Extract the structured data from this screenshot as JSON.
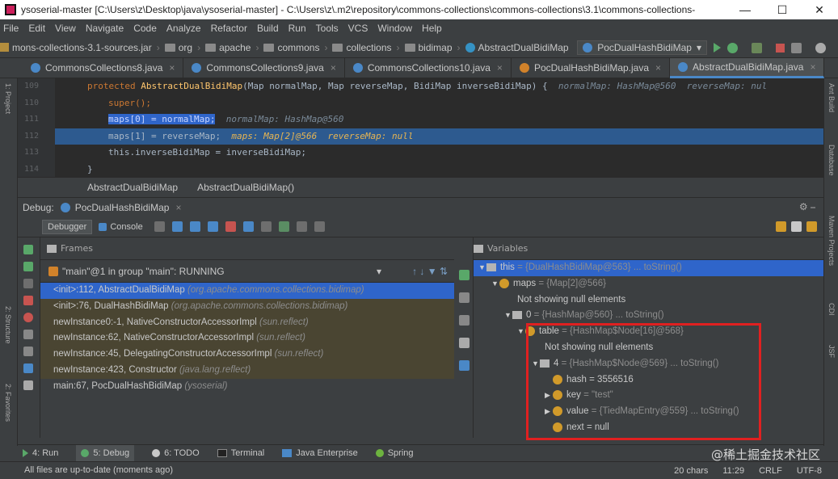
{
  "window": {
    "title": "ysoserial-master [C:\\Users\\z\\Desktop\\java\\ysoserial-master] - C:\\Users\\z\\.m2\\repository\\commons-collections\\commons-collections\\3.1\\commons-collections-",
    "controls": [
      "—",
      "☐",
      "✕"
    ]
  },
  "menu": [
    "File",
    "Edit",
    "View",
    "Navigate",
    "Code",
    "Analyze",
    "Refactor",
    "Build",
    "Run",
    "Tools",
    "VCS",
    "Window",
    "Help"
  ],
  "nav": {
    "crumbs": [
      "mons-collections-3.1-sources.jar",
      "org",
      "apache",
      "commons",
      "collections",
      "bidimap",
      "AbstractDualBidiMap"
    ],
    "run_config": "PocDualHashBidiMap"
  },
  "tabs": [
    {
      "label": "CommonsCollections8.java",
      "active": false
    },
    {
      "label": "CommonsCollections9.java",
      "active": false
    },
    {
      "label": "CommonsCollections10.java",
      "active": false
    },
    {
      "label": "PocDualHashBidiMap.java",
      "active": false
    },
    {
      "label": "AbstractDualBidiMap.java",
      "active": true
    }
  ],
  "editor": {
    "line_numbers": [
      "109",
      "110",
      "111",
      "112",
      "113",
      "114"
    ],
    "line0_kw": "protected ",
    "line0_fn": "AbstractDualBidiMap",
    "line0_rest": "(Map normalMap, Map reverseMap, BidiMap inverseBidiMap) {",
    "line0_inline": "normalMap: HashMap@560  reverseMap: nul",
    "line1": "super();",
    "line2_sel": "maps[0] = normalMap;",
    "line2_inline": "normalMap: HashMap@560",
    "line3_code": "maps[1] = reverseMap;",
    "line3_inline": "maps: Map[2]@566  reverseMap: null",
    "line4": "this.inverseBidiMap = inverseBidiMap;",
    "line5": "}"
  },
  "editor_breadcrumb": [
    "AbstractDualBidiMap",
    "AbstractDualBidiMap()"
  ],
  "debug": {
    "label": "Debug:",
    "session": "PocDualHashBidiMap",
    "tab_debugger": "Debugger",
    "tab_console": "Console"
  },
  "frames": {
    "header": "Frames",
    "thread": "\"main\"@1 in group \"main\": RUNNING",
    "items": [
      {
        "method": "<init>:112, AbstractDualBidiMap",
        "pkg": "(org.apache.commons.collections.bidimap)"
      },
      {
        "method": "<init>:76, DualHashBidiMap",
        "pkg": "(org.apache.commons.collections.bidimap)"
      },
      {
        "method": "newInstance0:-1, NativeConstructorAccessorImpl",
        "pkg": "(sun.reflect)"
      },
      {
        "method": "newInstance:62, NativeConstructorAccessorImpl",
        "pkg": "(sun.reflect)"
      },
      {
        "method": "newInstance:45, DelegatingConstructorAccessorImpl",
        "pkg": "(sun.reflect)"
      },
      {
        "method": "newInstance:423, Constructor",
        "pkg": "(java.lang.reflect)"
      },
      {
        "method": "main:67, PocDualHashBidiMap",
        "pkg": "(ysoserial)"
      }
    ]
  },
  "variables": {
    "header": "Variables",
    "rows": [
      {
        "name": "this",
        "val": "= {DualHashBidiMap@563}",
        "link": "... toString()"
      },
      {
        "name": "maps",
        "val": "= {Map[2]@566}",
        "link": ""
      },
      {
        "name": "Not showing null elements",
        "val": "",
        "link": ""
      },
      {
        "name": "0",
        "val": "= {HashMap@560}",
        "link": "... toString()"
      },
      {
        "name": "table",
        "val": "= {HashMap$Node[16]@568}",
        "link": ""
      },
      {
        "name": "Not showing null elements",
        "val": "",
        "link": ""
      },
      {
        "name": "4",
        "val": "= {HashMap$Node@569}",
        "link": "... toString()"
      },
      {
        "name": "hash",
        "val": "= 3556516",
        "link": ""
      },
      {
        "name": "key",
        "val": "= \"test\"",
        "link": ""
      },
      {
        "name": "value",
        "val": "= {TiedMapEntry@559}",
        "link": "... toString()"
      },
      {
        "name": "next",
        "val": "= null",
        "link": ""
      }
    ]
  },
  "bottom_tabs": [
    "4: Run",
    "5: Debug",
    "6: TODO",
    "Terminal",
    "Java Enterprise",
    "Spring"
  ],
  "status": {
    "message": "All files are up-to-date (moments ago)",
    "chars": "20 chars",
    "position": "11:29",
    "line_sep": "CRLF",
    "encoding": "UTF-8"
  },
  "watermark": "@稀土掘金技术社区",
  "side_labels": {
    "left": [
      "1: Project",
      "2: Structure",
      "2: Favorites"
    ],
    "right": [
      "Ant Build",
      "Database",
      "Maven Projects",
      "CDI",
      "JSF"
    ]
  },
  "colors": {
    "selection": "#2f65ca",
    "highlight_box": "#e02020"
  }
}
